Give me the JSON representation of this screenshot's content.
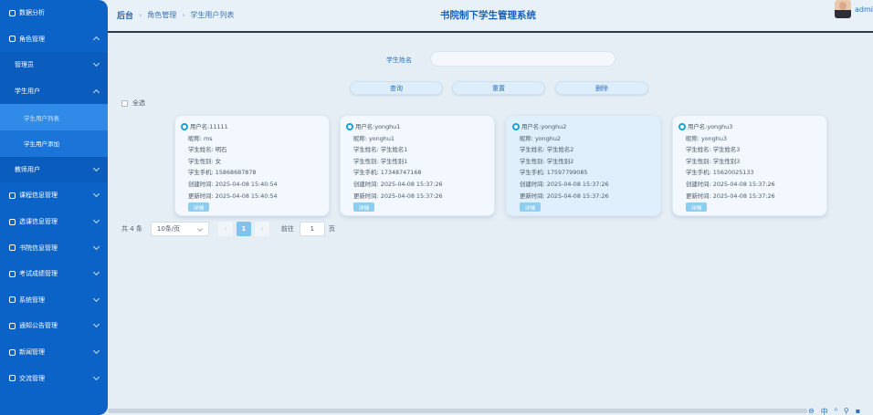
{
  "sidebar": {
    "items": [
      {
        "label": "数据分析"
      },
      {
        "label": "角色管理"
      },
      {
        "label": "管理员"
      },
      {
        "label": "学生用户"
      },
      {
        "label": "学生用户列表"
      },
      {
        "label": "学生用户添加"
      },
      {
        "label": "教师用户"
      },
      {
        "label": "课程信息管理"
      },
      {
        "label": "选课信息管理"
      },
      {
        "label": "书院信息管理"
      },
      {
        "label": "考试成绩管理"
      },
      {
        "label": "系统管理"
      },
      {
        "label": "通知公告管理"
      },
      {
        "label": "新闻管理"
      },
      {
        "label": "交流管理"
      }
    ]
  },
  "header": {
    "breadcrumb": [
      "后台",
      "角色管理",
      "学生用户列表"
    ],
    "title": "书院制下学生管理系统",
    "user": "admin"
  },
  "search": {
    "label": "学生姓名",
    "value": "",
    "buttons": {
      "query": "查询",
      "reset": "重置",
      "delete": "删除"
    },
    "select_all": "全选"
  },
  "field_labels": {
    "username": "用户名: ",
    "nickname": "昵称: ",
    "name": "学生姓名: ",
    "gender": "学生性别: ",
    "phone": "学生手机: ",
    "created": "创建时间: ",
    "updated": "更新时间: ",
    "detail": "详情"
  },
  "cards": [
    {
      "username": "11111",
      "nickname": "ms",
      "name": "明石",
      "gender": "女",
      "phone": "15868687878",
      "created": "2025-04-08 15:40:54",
      "updated": "2025-04-08 15:40:54"
    },
    {
      "username": "yonghu1",
      "nickname": "yonghu1",
      "name": "学生姓名1",
      "gender": "学生性别1",
      "phone": "17348747168",
      "created": "2025-04-08 15:37:26",
      "updated": "2025-04-08 15:37:26"
    },
    {
      "username": "yonghu2",
      "nickname": "yonghu2",
      "name": "学生姓名2",
      "gender": "学生性别2",
      "phone": "17597799085",
      "created": "2025-04-08 15:37:26",
      "updated": "2025-04-08 15:37:26"
    },
    {
      "username": "yonghu3",
      "nickname": "yonghu3",
      "name": "学生姓名3",
      "gender": "学生性别3",
      "phone": "15620025133",
      "created": "2025-04-08 15:37:26",
      "updated": "2025-04-08 15:37:26"
    }
  ],
  "pagination": {
    "total": "共 4 条",
    "page_size": "10条/页",
    "prev": "‹",
    "page": "1",
    "next": "›",
    "goto_label": "前往",
    "goto_value": "1",
    "page_suffix": "页"
  },
  "tray": [
    "⊖",
    "中",
    "⁰",
    "⚲",
    "▪"
  ]
}
